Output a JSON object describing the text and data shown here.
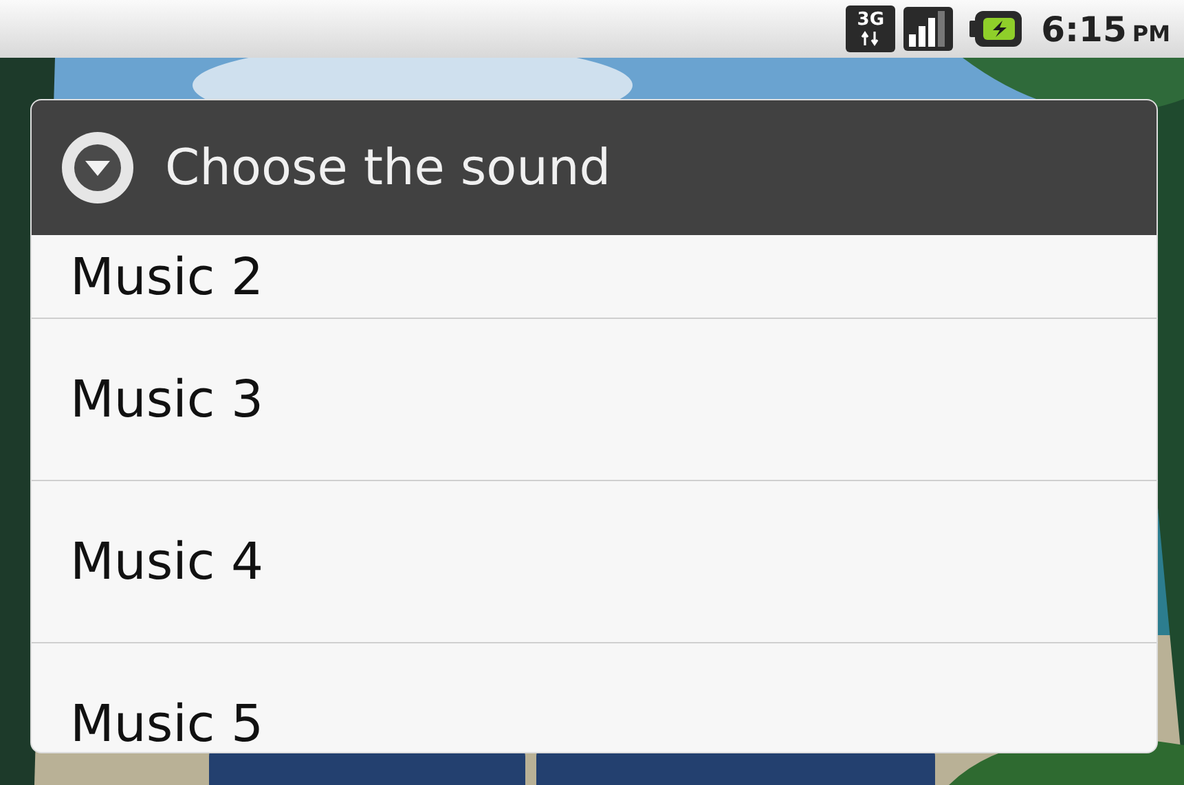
{
  "status_bar": {
    "network": "3G",
    "time": "6:15",
    "meridiem": "PM"
  },
  "dialog": {
    "title": "Choose the sound",
    "items": [
      {
        "label": "Music 2"
      },
      {
        "label": "Music 3"
      },
      {
        "label": "Music 4"
      },
      {
        "label": "Music 5"
      }
    ]
  }
}
